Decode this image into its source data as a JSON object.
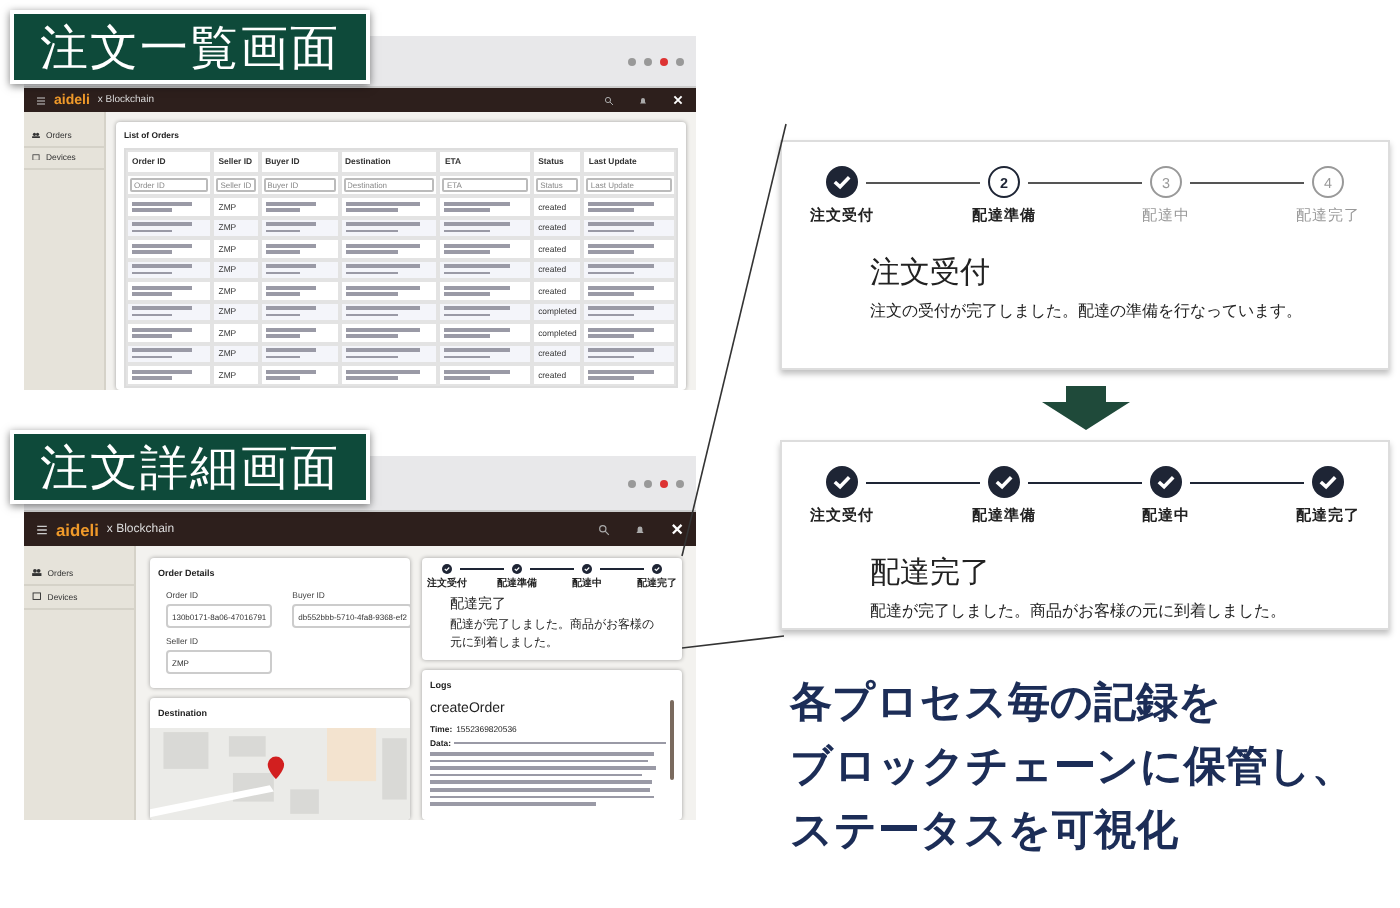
{
  "list_screen": {
    "label": "注文一覧画面",
    "logo": "aideli",
    "logo_suffix": "x Blockchain",
    "sidebar_items": [
      {
        "label": "Orders",
        "selected": false
      },
      {
        "label": "Devices",
        "selected": false
      }
    ],
    "card_title": "List of Orders",
    "columns": [
      "Order ID",
      "Seller ID",
      "Buyer ID",
      "Destination",
      "ETA",
      "Status",
      "Last Update"
    ],
    "filters": [
      {
        "placeholder": "Order ID"
      },
      {
        "placeholder": "Seller ID"
      },
      {
        "placeholder": "Buyer ID"
      },
      {
        "placeholder": "Destination"
      },
      {
        "placeholder": "ETA"
      },
      {
        "placeholder": "Status"
      },
      {
        "placeholder": "Last Update"
      }
    ],
    "rows": [
      {
        "seller": "ZMP",
        "status": "created"
      },
      {
        "seller": "ZMP",
        "status": "created"
      },
      {
        "seller": "ZMP",
        "status": "created"
      },
      {
        "seller": "ZMP",
        "status": "created"
      },
      {
        "seller": "ZMP",
        "status": "created"
      },
      {
        "seller": "ZMP",
        "status": "completed"
      },
      {
        "seller": "ZMP",
        "status": "completed"
      },
      {
        "seller": "ZMP",
        "status": "created"
      },
      {
        "seller": "ZMP",
        "status": "created"
      }
    ]
  },
  "detail_screen": {
    "label": "注文詳細画面",
    "logo": "aideli",
    "logo_suffix": "x Blockchain",
    "sidebar_items": [
      {
        "label": "Orders",
        "selected": false
      },
      {
        "label": "Devices",
        "selected": false
      }
    ],
    "details_title": "Order Details",
    "fields": [
      {
        "label": "Order ID",
        "value": "130b0171-8a06-47016791"
      },
      {
        "label": "Buyer ID",
        "value": "db552bbb-5710-4fa8-9368-ef2"
      },
      {
        "label": "Seller ID",
        "value": "ZMP"
      }
    ],
    "destination_title": "Destination",
    "stepper": {
      "steps": [
        {
          "label": "注文受付",
          "completed": true
        },
        {
          "label": "配達準備",
          "completed": true
        },
        {
          "label": "配達中",
          "completed": true
        },
        {
          "label": "配達完了",
          "completed": true
        }
      ],
      "title": "配達完了",
      "message": "配達が完了しました。商品がお客様の元に到着しました。"
    },
    "logs": {
      "title": "Logs",
      "event": "createOrder",
      "time_label": "Time:",
      "time": "1552369820536",
      "data_label": "Data:"
    }
  },
  "status_cards": [
    {
      "steps": [
        {
          "label": "注文受付",
          "completed": true
        },
        {
          "label": "配達準備",
          "completed": false,
          "active": true,
          "number": "2"
        },
        {
          "label": "配達中",
          "completed": false,
          "active": false,
          "number": "3"
        },
        {
          "label": "配達完了",
          "completed": false,
          "active": false,
          "number": "4"
        }
      ],
      "title": "注文受付",
      "message": "注文の受付が完了しました。配達の準備を行なっています。"
    },
    {
      "steps": [
        {
          "label": "注文受付",
          "completed": true
        },
        {
          "label": "配達準備",
          "completed": true
        },
        {
          "label": "配達中",
          "completed": true
        },
        {
          "label": "配達完了",
          "completed": true
        }
      ],
      "title": "配達完了",
      "message": "配達が完了しました。商品がお客様の元に到着しました。"
    }
  ],
  "caption": [
    "各プロセス毎の記録を",
    "ブロックチェーンに保管し、",
    "ステータスを可視化"
  ]
}
